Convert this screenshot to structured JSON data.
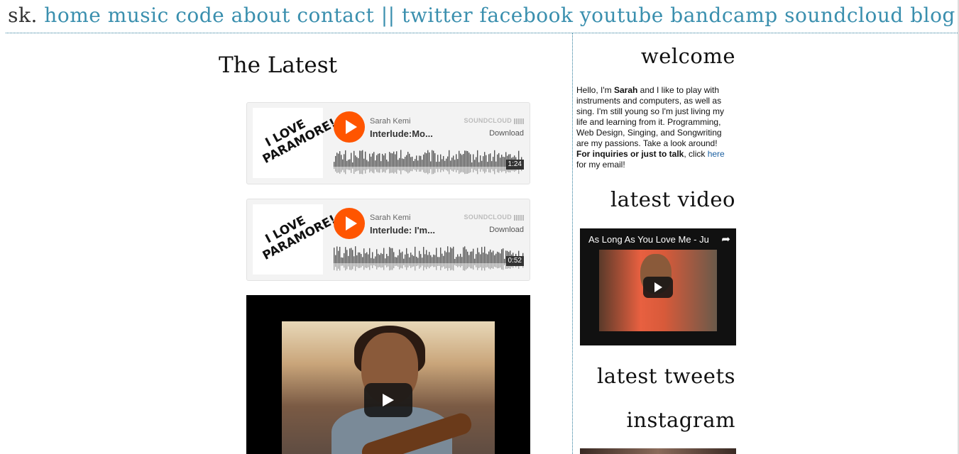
{
  "nav": {
    "brand": "sk.",
    "links": [
      "home",
      "music",
      "code",
      "about",
      "contact"
    ],
    "separator": "||",
    "social": [
      "twitter",
      "facebook",
      "youtube",
      "bandcamp",
      "soundcloud",
      "blog"
    ]
  },
  "main": {
    "title": "The Latest",
    "tracks": [
      {
        "artwork_text": "I LOVE PARAMORE!",
        "artist": "Sarah Kemi",
        "title": "Interlude:Mo...",
        "brand": "SOUNDCLOUD",
        "download": "Download",
        "duration": "1:24"
      },
      {
        "artwork_text": "I LOVE PARAMORE!",
        "artist": "Sarah Kemi",
        "title": "Interlude: I'm...",
        "brand": "SOUNDCLOUD",
        "download": "Download",
        "duration": "0:52"
      }
    ]
  },
  "sidebar": {
    "welcome_heading": "welcome",
    "welcome": {
      "p1": "Hello, I'm ",
      "name": "Sarah",
      "p2": " and I like to play with instruments and computers, as well as sing. I'm still young so I'm just living my life and learning from it. Programming, Web Design, Singing, and Songwriting are my passions. Take a look around!",
      "inquiry_bold": "For inquiries or just to talk",
      "p3": ", click ",
      "link": "here",
      "p4": " for my email!"
    },
    "video_heading": "latest video",
    "video_title": "As Long As You Love Me - Ju",
    "tweets_heading": "latest tweets",
    "instagram_heading": "instagram"
  },
  "colors": {
    "link": "#3a8fae",
    "soundcloud_orange": "#ff5500"
  }
}
